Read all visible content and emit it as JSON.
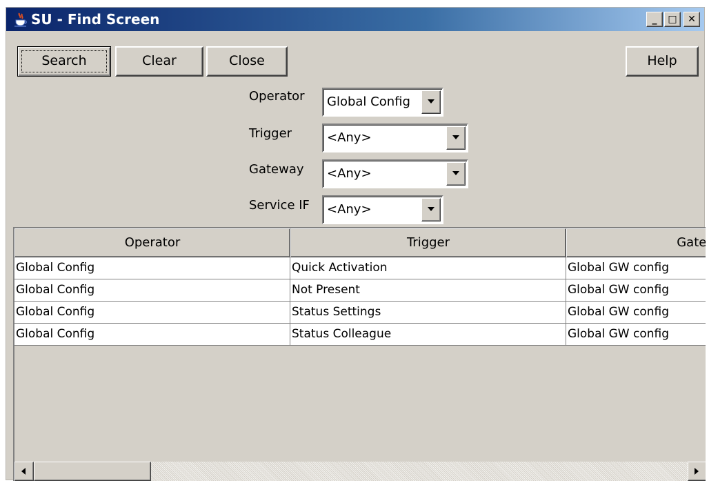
{
  "window": {
    "title": "SU - Find Screen",
    "icon": "java-cup-icon",
    "controls": {
      "minimize": "_",
      "maximize": "□",
      "close": "✕"
    }
  },
  "toolbar": {
    "search_label": "Search",
    "clear_label": "Clear",
    "close_label": "Close",
    "help_label": "Help"
  },
  "filters": {
    "operator": {
      "label": "Operator",
      "value": "Global Config"
    },
    "trigger": {
      "label": "Trigger",
      "value": "<Any>"
    },
    "gateway": {
      "label": "Gateway",
      "value": "<Any>"
    },
    "service_if": {
      "label": "Service IF",
      "value": "<Any>"
    }
  },
  "table": {
    "columns": [
      "Operator",
      "Trigger",
      "Gateway"
    ],
    "rows": [
      [
        "Global Config",
        "Quick Activation",
        "Global GW config"
      ],
      [
        "Global Config",
        "Not Present",
        "Global GW config"
      ],
      [
        "Global Config",
        "Status Settings",
        "Global GW config"
      ],
      [
        "Global Config",
        "Status Colleague",
        "Global GW config"
      ]
    ]
  },
  "colors": {
    "titlebar_start": "#0a246a",
    "titlebar_end": "#a6caf0",
    "face": "#d4d0c8"
  }
}
